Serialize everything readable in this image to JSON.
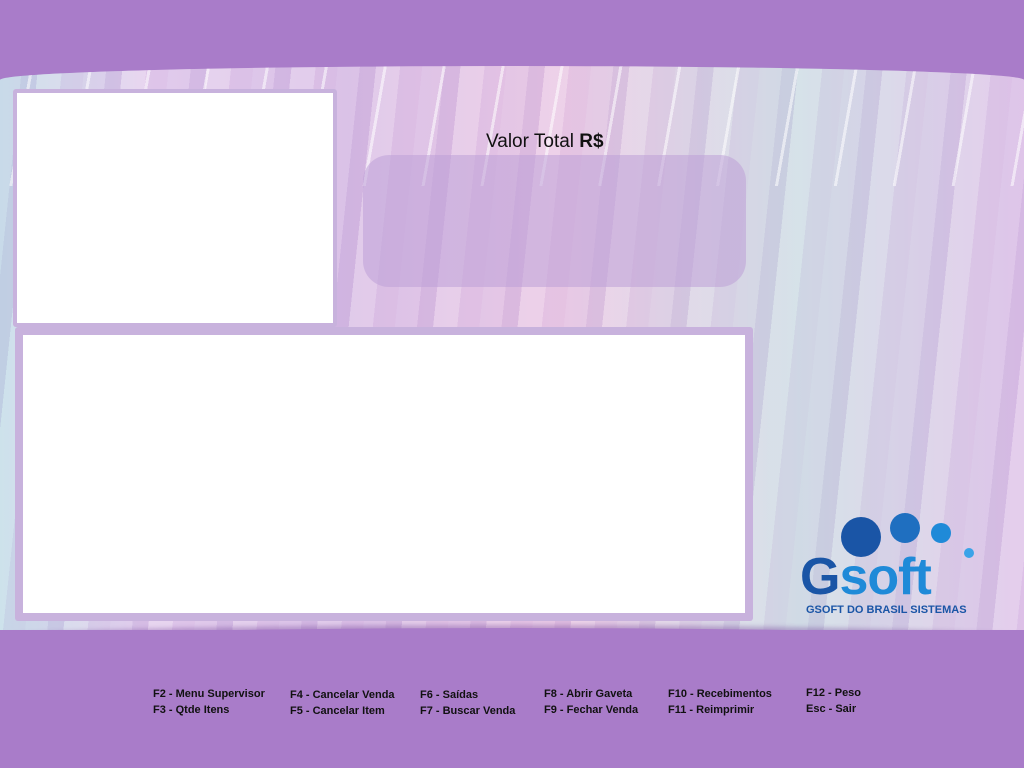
{
  "total": {
    "label": "Valor Total",
    "currency": "R$"
  },
  "logo": {
    "letter": "G",
    "word": "soft",
    "tagline": "GSOFT DO BRASIL SISTEMAS"
  },
  "shortcuts": [
    [
      "F2 - Menu Supervisor",
      "F3 - Qtde Itens"
    ],
    [
      "F4 - Cancelar Venda",
      "F5 - Cancelar Item"
    ],
    [
      "F6 - Saídas",
      "F7 - Buscar Venda"
    ],
    [
      "F8 - Abrir Gaveta",
      "F9 - Fechar Venda"
    ],
    [
      "F10 - Recebimentos",
      "F11 - Reimprimir"
    ],
    [
      "F12 - Peso",
      "Esc - Sair"
    ]
  ],
  "colors": {
    "brand_purple": "#a97cc9",
    "logo_dark_blue": "#1a55a6",
    "logo_light_blue": "#1f8ad8"
  }
}
